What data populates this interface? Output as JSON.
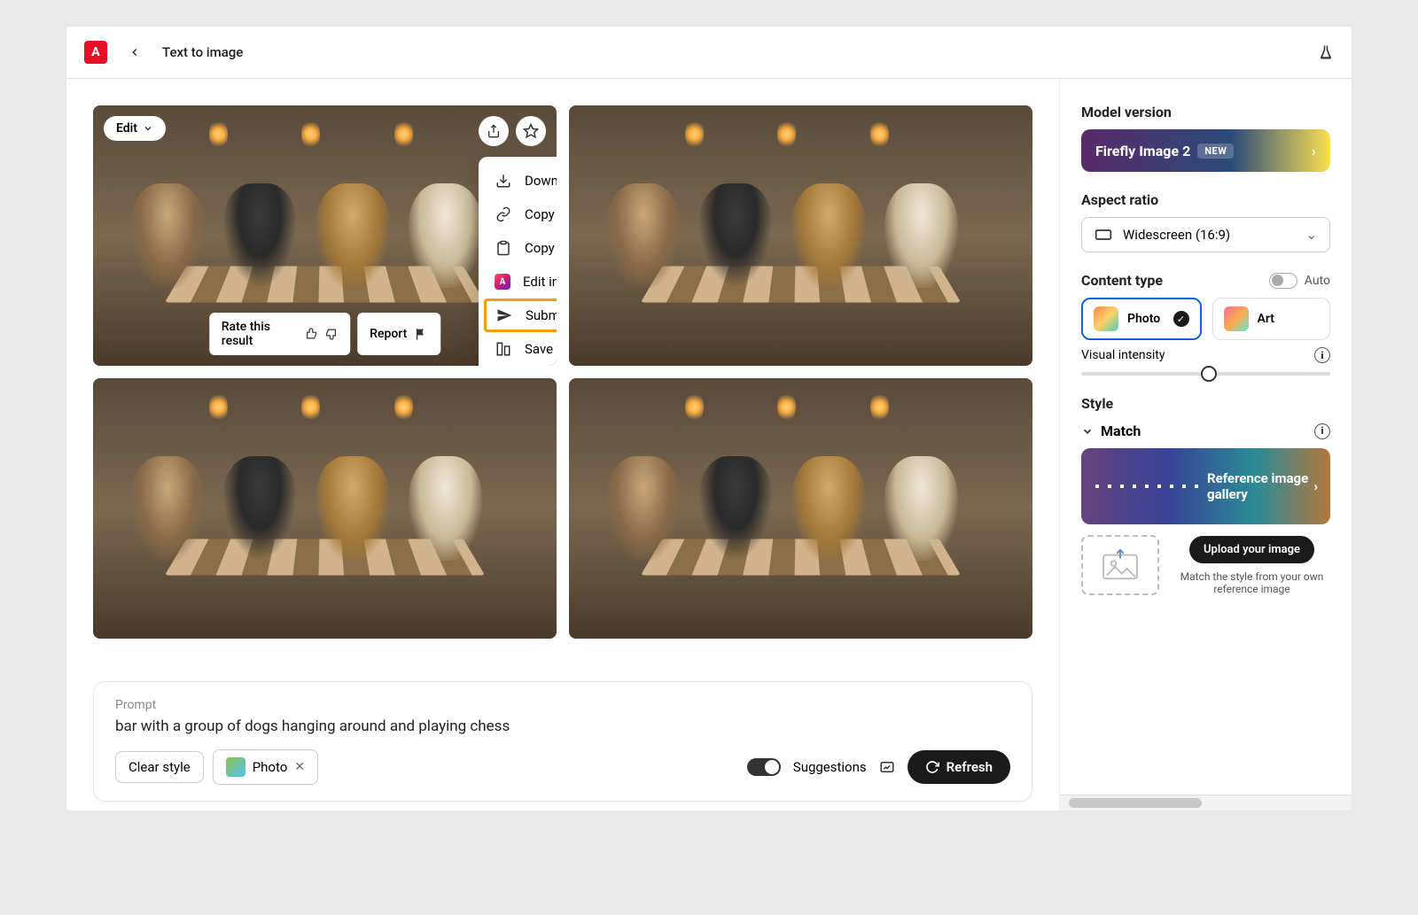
{
  "header": {
    "title": "Text to image"
  },
  "edit_button": "Edit",
  "rate_label": "Rate this result",
  "report_label": "Report",
  "share_menu": {
    "download": "Download",
    "copy_link": "Copy link",
    "copy_image": "Copy image",
    "edit_express": "Edit in Adobe Express",
    "submit": "Submit to Firefly Community",
    "save_library": "Save to library"
  },
  "prompt": {
    "label": "Prompt",
    "text": "bar with a group of dogs hanging around and playing chess",
    "clear_style": "Clear style",
    "photo_chip": "Photo",
    "suggestions": "Suggestions",
    "refresh": "Refresh"
  },
  "sidebar": {
    "model_version": "Model version",
    "model_name": "Firefly Image 2",
    "model_badge": "NEW",
    "aspect_ratio": "Aspect ratio",
    "aspect_value": "Widescreen (16:9)",
    "content_type": "Content type",
    "auto": "Auto",
    "ct_photo": "Photo",
    "ct_art": "Art",
    "visual_intensity": "Visual intensity",
    "style": "Style",
    "match": "Match",
    "ref_gallery": "Reference image gallery",
    "upload_btn": "Upload your image",
    "upload_desc": "Match the style from your own reference image"
  }
}
